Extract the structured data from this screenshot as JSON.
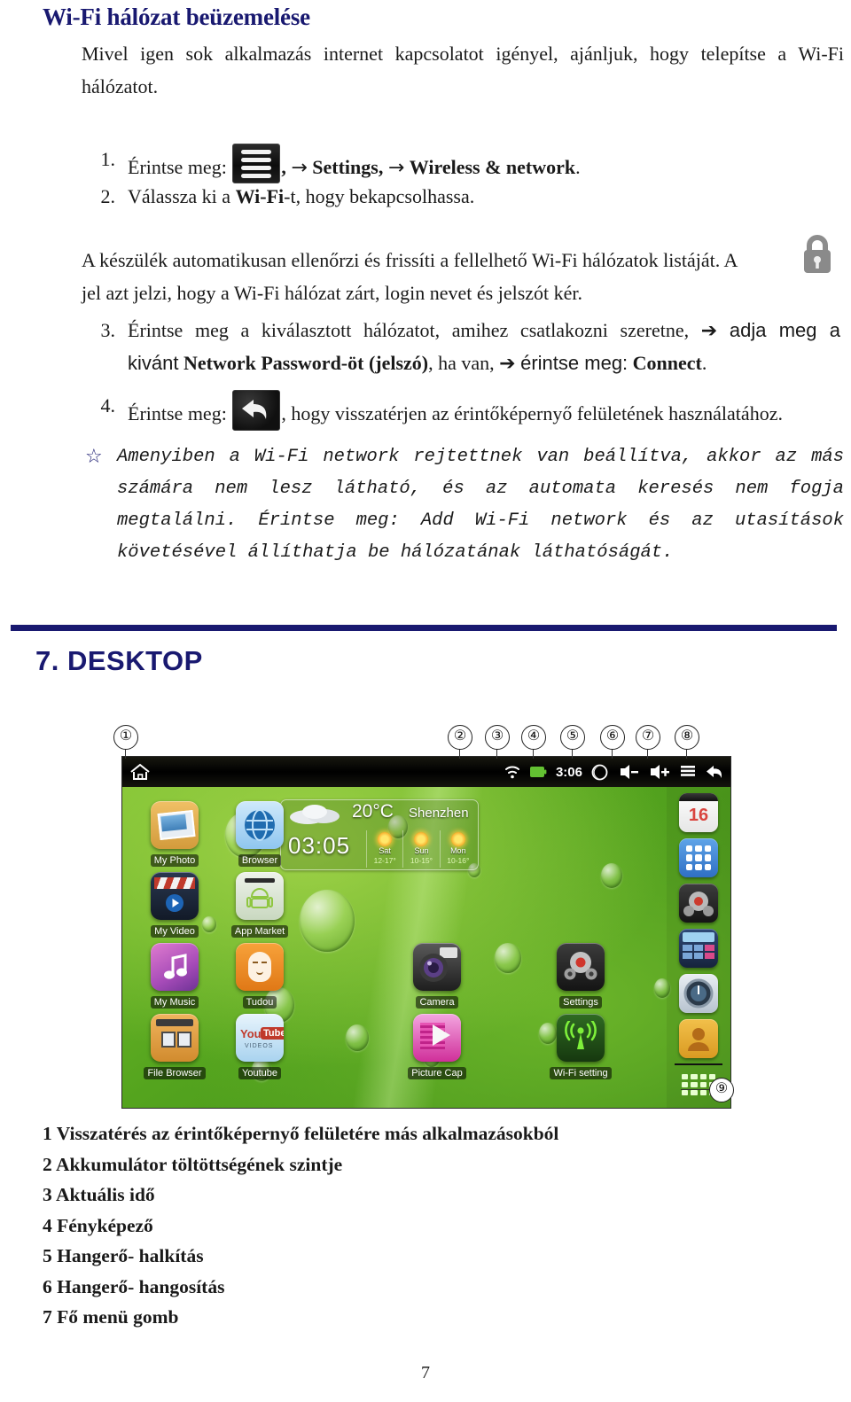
{
  "document": {
    "title": "Wi-Fi hálózat beüzemelése",
    "intro": "Mivel igen sok alkalmazás internet kapcsolatot igényel, ajánljuk, hogy telepítse a Wi-Fi hálózatot.",
    "page_number": "7"
  },
  "steps": [
    {
      "number": "1.",
      "prefix": "Érintse meg:",
      "icon": "menu-icon",
      "suffix_plain": ", ",
      "arrow": "→",
      "bold1": "Settings",
      "mid": ", ",
      "bold2": "Wireless & network",
      "end": "."
    },
    {
      "number": "2.",
      "text_before": "Válassza ki a ",
      "bold": "Wi-Fi",
      "text_after": "-t, hogy bekapcsolhassa."
    },
    {
      "number": "3.",
      "line1_a": "Érintse meg a kiválasztott hálózatot, amihez csatlakozni szeretne,",
      "arrow": "➔",
      "line1_b": "adja meg a",
      "line2_a": "kivánt",
      "line2_bold1": "Network Password-öt (jelszó)",
      "line2_b": ", ha van,",
      "line2_c": "érintse meg:",
      "line2_bold2": "Connect",
      "line2_end": "."
    },
    {
      "number": "4.",
      "prefix": "Érintse meg:",
      "icon": "back-arrow-icon",
      "suffix": ", hogy visszatérjen az érintőképernyő felületének használatához."
    }
  ],
  "auto_paragraph": {
    "line1": "A készülék automatikusan ellenőrzi és frissíti a fellelhető Wi-Fi hálózatok listáját. A",
    "line2": "jel azt jelzi, hogy a Wi-Fi hálózat zárt, login nevet és jelszót kér.",
    "icon": "padlock-icon"
  },
  "note": {
    "bullet": "☆",
    "text": "Amenyiben a Wi-Fi network rejtettnek van beállítva, akkor az más számára nem lesz látható, és az automata keresés nem fogja megtalálni. Érintse meg: Add Wi-Fi network és az utasítások követésével állíthatja be hálózatának láthatóságát."
  },
  "section": {
    "heading": "7. DESKTOP"
  },
  "figure": {
    "callouts": [
      "①",
      "②",
      "③",
      "④",
      "⑤",
      "⑥",
      "⑦",
      "⑧",
      "⑨"
    ],
    "statusbar": {
      "home_icon": "home-icon",
      "wifi_icon": "wifi-signal-icon",
      "battery_icon": "battery-icon",
      "time": "3:06",
      "camera_icon": "camera-icon",
      "volume_down_icon": "volume-down-icon",
      "volume_down_label": "◁−",
      "volume_up_icon": "volume-up-icon",
      "volume_up_label": "◁+",
      "menu_icon": "menu-icon",
      "back_icon": "back-arrow-icon"
    },
    "apps": [
      {
        "label": "My Photo",
        "icon": "my-photo-icon"
      },
      {
        "label": "Browser",
        "icon": "browser-icon"
      },
      {
        "label": "My Video",
        "icon": "my-video-icon"
      },
      {
        "label": "App Market",
        "icon": "app-market-icon"
      },
      {
        "label": "My Music",
        "icon": "my-music-icon"
      },
      {
        "label": "Tudou",
        "icon": "tudou-icon"
      },
      {
        "label": "File Browser",
        "icon": "file-browser-icon"
      },
      {
        "label": "Youtube",
        "icon": "youtube-icon"
      },
      {
        "label": "Camera",
        "icon": "camera-app-icon"
      },
      {
        "label": "Settings",
        "icon": "settings-gear-icon"
      },
      {
        "label": "Picture Cap",
        "icon": "picture-cap-icon"
      },
      {
        "label": "Wi-Fi setting",
        "icon": "wifi-setting-icon"
      }
    ],
    "dock": [
      {
        "icon": "calendar-icon",
        "label": "16"
      },
      {
        "icon": "apps-grid-icon",
        "label": ""
      },
      {
        "icon": "settings-gear-icon",
        "label": ""
      },
      {
        "icon": "calculator-icon",
        "label": ""
      },
      {
        "icon": "clock-icon",
        "label": ""
      },
      {
        "icon": "contacts-icon",
        "label": ""
      }
    ],
    "drawer_icon": "app-drawer-icon",
    "weather": {
      "temperature": "20°C",
      "city": "Shenzhen",
      "clock": "03:05",
      "days": [
        {
          "name": "Sat",
          "range": "12-17°"
        },
        {
          "name": "Sun",
          "range": "10-15°"
        },
        {
          "name": "Mon",
          "range": "10-16°"
        }
      ]
    }
  },
  "legend": [
    "1 Visszatérés az érintőképernyő felületére más alkalmazásokból",
    "2 Akkumulátor töltöttségének szintje",
    "3 Aktuális idő",
    "4 Fényképező",
    "5 Hangerő- halkítás",
    "6 Hangerő- hangosítás",
    "7 Fő menü gomb"
  ],
  "colors": {
    "heading": "#191970",
    "rule": "#191970",
    "text": "#1a1a1a"
  }
}
